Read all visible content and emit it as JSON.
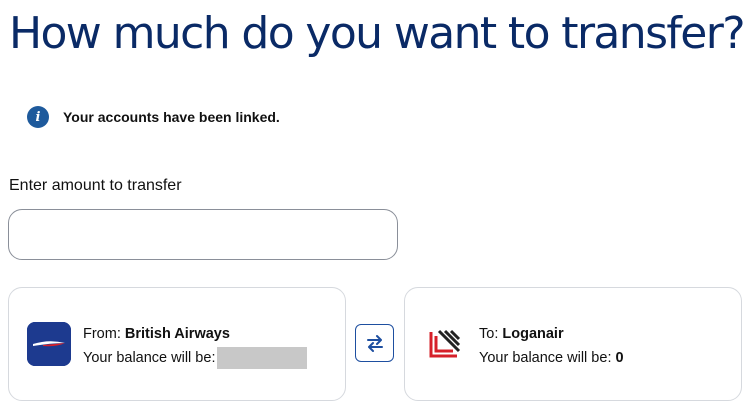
{
  "page": {
    "title": "How much do you want to transfer?"
  },
  "notice": {
    "icon": "info-icon",
    "text": "Your accounts have been linked."
  },
  "amount": {
    "label": "Enter amount to transfer",
    "value": "",
    "placeholder": ""
  },
  "from_card": {
    "logo": "british-airways-logo",
    "prefix": "From:",
    "airline": "British Airways",
    "balance_label": "Your balance will be:",
    "balance_value": ""
  },
  "to_card": {
    "logo": "loganair-logo",
    "prefix": "To:",
    "airline": "Loganair",
    "balance_label": "Your balance will be:",
    "balance_value": "0"
  },
  "swap": {
    "icon": "swap-arrows-icon"
  },
  "colors": {
    "title": "#0a2a66",
    "accent": "#1e4fa0",
    "ba_blue": "#1d3a8f",
    "loganair_red": "#d6202a"
  }
}
